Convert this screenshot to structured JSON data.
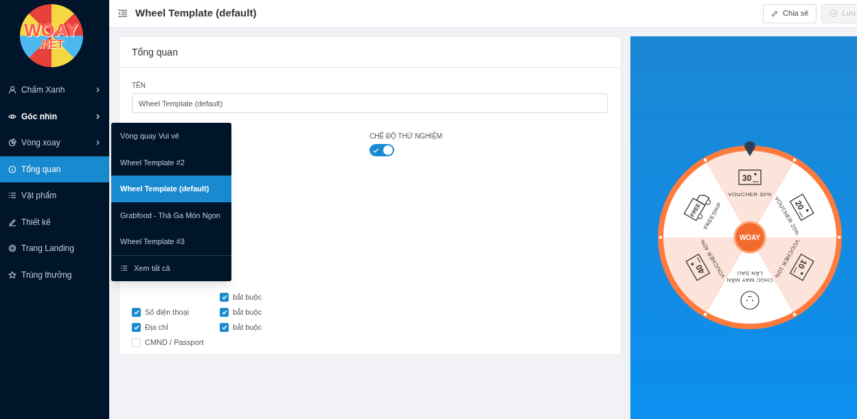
{
  "logo": {
    "word": "WOAY",
    "suffix": ".NET"
  },
  "sidebar": {
    "items": [
      {
        "label": "Chấm Xanh",
        "has_submenu": true,
        "selected": false,
        "hovered": false
      },
      {
        "label": "Góc nhìn",
        "has_submenu": true,
        "selected": false,
        "hovered": true
      },
      {
        "label": "Vòng xoay",
        "has_submenu": true,
        "selected": false,
        "hovered": false
      },
      {
        "label": "Tổng quan",
        "has_submenu": false,
        "selected": true,
        "hovered": false
      },
      {
        "label": "Vật phẩm",
        "has_submenu": false,
        "selected": false,
        "hovered": false
      },
      {
        "label": "Thiết kế",
        "has_submenu": false,
        "selected": false,
        "hovered": false
      },
      {
        "label": "Trang Landing",
        "has_submenu": false,
        "selected": false,
        "hovered": false
      },
      {
        "label": "Trúng thưởng",
        "has_submenu": false,
        "selected": false,
        "hovered": false
      }
    ]
  },
  "header": {
    "title": "Wheel Template (default)",
    "buttons": [
      {
        "label": "Chia sẻ",
        "disabled": false
      },
      {
        "label": "Lưu",
        "disabled": true
      }
    ]
  },
  "dropdown": {
    "items": [
      {
        "label": "Vòng quay Vui vẻ",
        "selected": false
      },
      {
        "label": "Wheel Template #2",
        "selected": false
      },
      {
        "label": "Wheel Template (default)",
        "selected": true
      },
      {
        "label": "Grabfood - Thả Ga Món Ngon",
        "selected": false
      },
      {
        "label": "Wheel Template #3",
        "selected": false
      }
    ],
    "footer": "Xem tất cả"
  },
  "card": {
    "title": "Tổng quan",
    "name_label": "TÊN",
    "name_value": "Wheel Template (default)",
    "test_mode": {
      "label": "CHẾ ĐỘ THỬ NGHIỆM",
      "on": true
    },
    "fields": [
      {
        "required_label": "bắt buộc",
        "required": true
      },
      {
        "label": "Số điện thoại",
        "checked": true,
        "required_label": "bắt buộc",
        "required": true
      },
      {
        "label": "Địa chỉ",
        "checked": true,
        "required_label": "bắt buộc",
        "required": true
      },
      {
        "label": "CMND / Passport",
        "checked": false
      }
    ]
  },
  "wheel": {
    "center": "WOAY",
    "slices": [
      {
        "kind": "voucher",
        "badge": "30",
        "label": "VOUCHER 30%",
        "color": "#fce4da"
      },
      {
        "kind": "voucher",
        "badge": "20",
        "label": "VOUCHER 20%",
        "color": "#ffffff"
      },
      {
        "kind": "voucher",
        "badge": "10",
        "label": "VOUCHER 10%",
        "color": "#fce4da"
      },
      {
        "kind": "smiley",
        "label": "CHÚC MAY MẮN",
        "label2": "LẦN SAU",
        "color": "#ffffff"
      },
      {
        "kind": "voucher",
        "badge": "40",
        "label": "VOUCHER 40%",
        "color": "#fce4da"
      },
      {
        "kind": "freeship",
        "badge": "FREE",
        "label": "FREESHIP",
        "color": "#ffffff"
      }
    ]
  }
}
